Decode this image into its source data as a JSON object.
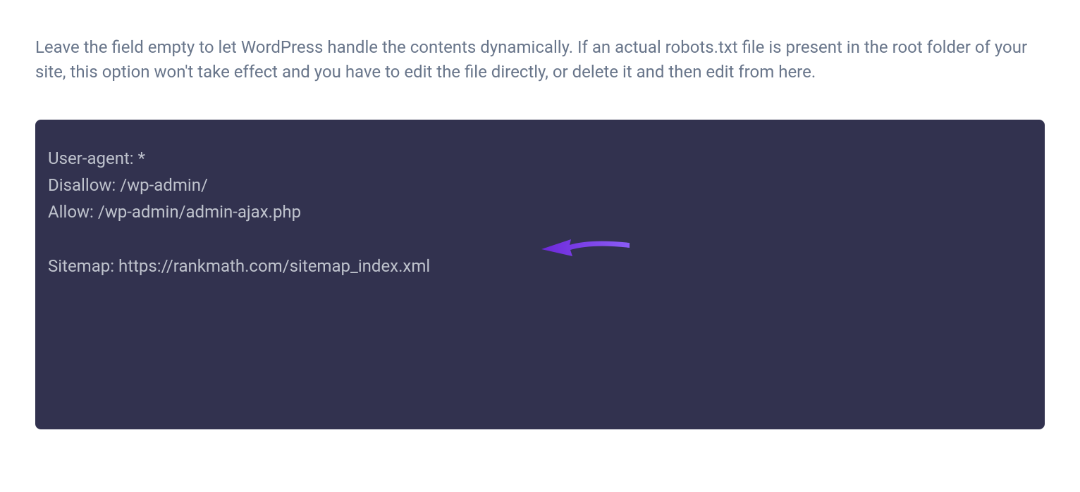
{
  "description": "Leave the field empty to let WordPress handle the contents dynamically. If an actual robots.txt file is present in the root folder of your site, this option won't take effect and you have to edit the file directly, or delete it and then edit from here.",
  "robots_txt": {
    "line1": "User-agent: *",
    "line2": "Disallow: /wp-admin/",
    "line3": "Allow: /wp-admin/admin-ajax.php",
    "line4": "",
    "line5": "Sitemap: https://rankmath.com/sitemap_index.xml"
  },
  "annotation": {
    "arrow_color": "#7c3aed"
  }
}
